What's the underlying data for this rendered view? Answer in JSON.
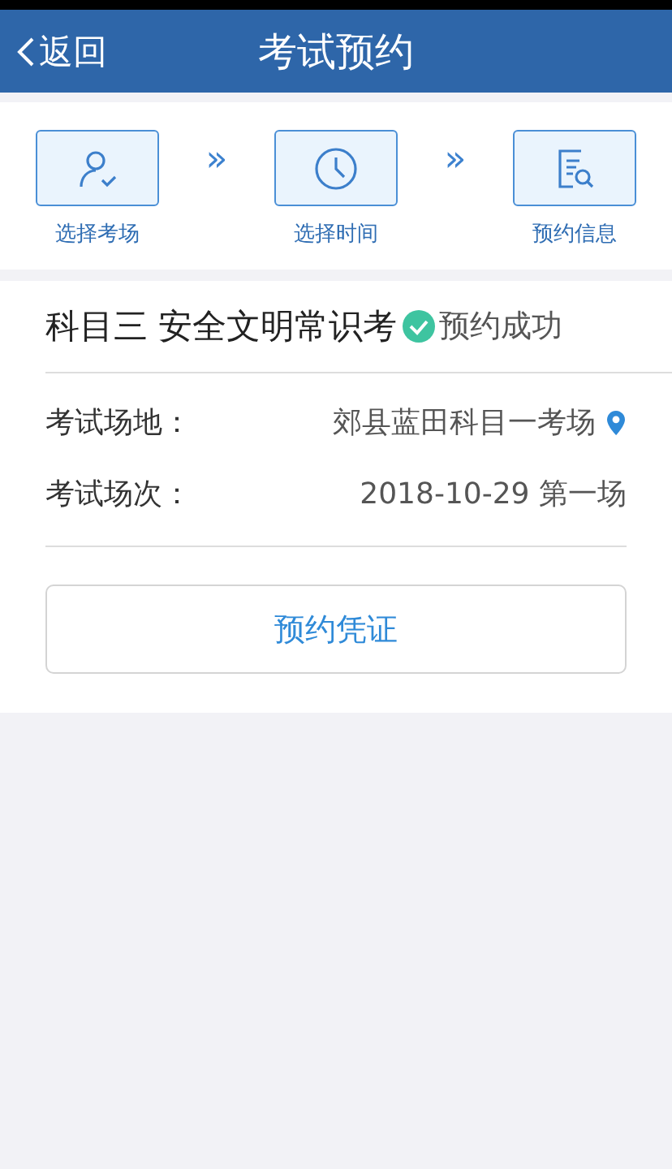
{
  "header": {
    "back": "返回",
    "title": "考试预约"
  },
  "steps": [
    {
      "kind": "person",
      "label": "选择考场"
    },
    {
      "kind": "clock",
      "label": "选择时间"
    },
    {
      "kind": "document",
      "label": "预约信息"
    }
  ],
  "step_separator": "»",
  "booking": {
    "subject": "科目三 安全文明常识考",
    "status": "预约成功",
    "fields": [
      {
        "label": "考试场地：",
        "value": "郊县蓝田科目一考场",
        "kind": "location"
      },
      {
        "label": "考试场次：",
        "value": "2018-10-29 第一场",
        "kind": "plain"
      }
    ],
    "button": "预约凭证"
  }
}
